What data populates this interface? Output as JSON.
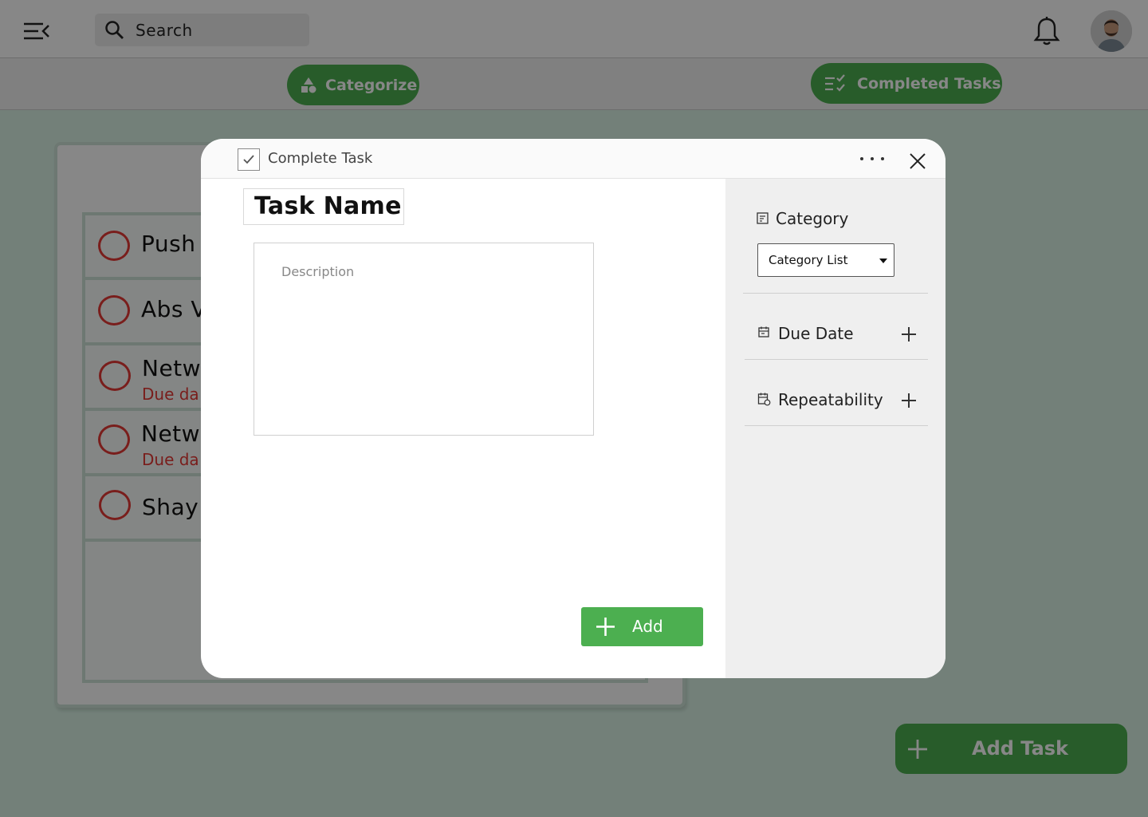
{
  "topbar": {
    "search_placeholder": "Search"
  },
  "toolbar": {
    "categorize_label": "Categorize",
    "completed_label": "Completed Tasks"
  },
  "tasks": [
    {
      "name": "Push",
      "due": ""
    },
    {
      "name": "Abs V",
      "due": ""
    },
    {
      "name": "Netw",
      "due": "Due da"
    },
    {
      "name": "Netw",
      "due": "Due da"
    },
    {
      "name": "Shay",
      "due": ""
    }
  ],
  "add_task_label": "Add Task",
  "modal": {
    "complete_label": "Complete Task",
    "task_name": "Task Name",
    "description_placeholder": "Description",
    "add_label": "Add",
    "category_title": "Category",
    "category_select": "Category List",
    "due_date_title": "Due Date",
    "repeatability_title": "Repeatability"
  },
  "colors": {
    "accent": "#4caf50",
    "danger": "#e53935",
    "overlay": "rgba(0,0,0,0.47)"
  }
}
